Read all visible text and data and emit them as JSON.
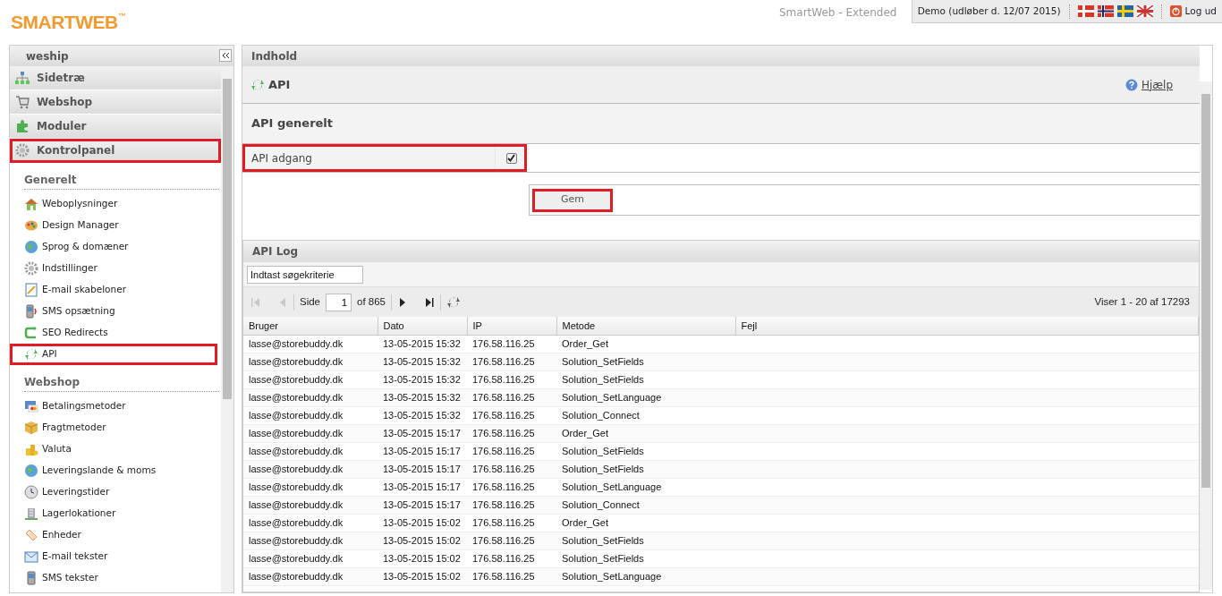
{
  "header": {
    "logo": "SMARTWEB",
    "logo_mark": "™",
    "edition": "SmartWeb - Extended",
    "account": "Demo (udløber d. 12/07 2015)",
    "logout": "Log ud"
  },
  "sidebar": {
    "title": "weship",
    "sections": [
      {
        "label": "Sidetræ",
        "highlighted": false
      },
      {
        "label": "Webshop",
        "highlighted": false
      },
      {
        "label": "Moduler",
        "highlighted": false
      },
      {
        "label": "Kontrolpanel",
        "highlighted": true
      }
    ],
    "groups": [
      {
        "heading": "Generelt",
        "items": [
          {
            "label": "Weboplysninger",
            "highlighted": false
          },
          {
            "label": "Design Manager",
            "highlighted": false
          },
          {
            "label": "Sprog & domæner",
            "highlighted": false
          },
          {
            "label": "Indstillinger",
            "highlighted": false
          },
          {
            "label": "E-mail skabeloner",
            "highlighted": false
          },
          {
            "label": "SMS opsætning",
            "highlighted": false
          },
          {
            "label": "SEO Redirects",
            "highlighted": false
          },
          {
            "label": "API",
            "highlighted": true
          }
        ]
      },
      {
        "heading": "Webshop",
        "items": [
          {
            "label": "Betalingsmetoder",
            "highlighted": false
          },
          {
            "label": "Fragtmetoder",
            "highlighted": false
          },
          {
            "label": "Valuta",
            "highlighted": false
          },
          {
            "label": "Leveringslande & moms",
            "highlighted": false
          },
          {
            "label": "Leveringstider",
            "highlighted": false
          },
          {
            "label": "Lagerlokationer",
            "highlighted": false
          },
          {
            "label": "Enheder",
            "highlighted": false
          },
          {
            "label": "E-mail tekster",
            "highlighted": false
          },
          {
            "label": "SMS tekster",
            "highlighted": false
          }
        ]
      }
    ]
  },
  "content": {
    "panel_title": "Indhold",
    "page_title": "API",
    "help": "Hjælp",
    "section_title": "API generelt",
    "field": {
      "label": "API adgang",
      "checked": true,
      "highlighted": true
    },
    "save": {
      "label": "Gem",
      "highlighted": true
    },
    "log": {
      "title": "API Log",
      "search": {
        "placeholder": "Indtast søgekriterie"
      },
      "pager": {
        "buttons": [
          {
            "disabled": true
          },
          {
            "disabled": true
          },
          {
            "disabled": false
          },
          {
            "disabled": false
          }
        ],
        "label": "Side",
        "page": "1",
        "of": "of 865",
        "summary": "Viser 1 - 20 af 17293"
      },
      "columns": [
        "Bruger",
        "Dato",
        "IP",
        "Metode",
        "Fejl"
      ],
      "rows": [
        [
          "lasse@storebuddy.dk",
          "13-05-2015 15:32",
          "176.58.116.25",
          "Order_Get"
        ],
        [
          "lasse@storebuddy.dk",
          "13-05-2015 15:32",
          "176.58.116.25",
          "Solution_SetFields"
        ],
        [
          "lasse@storebuddy.dk",
          "13-05-2015 15:32",
          "176.58.116.25",
          "Solution_SetFields"
        ],
        [
          "lasse@storebuddy.dk",
          "13-05-2015 15:32",
          "176.58.116.25",
          "Solution_SetLanguage"
        ],
        [
          "lasse@storebuddy.dk",
          "13-05-2015 15:32",
          "176.58.116.25",
          "Solution_Connect"
        ],
        [
          "lasse@storebuddy.dk",
          "13-05-2015 15:17",
          "176.58.116.25",
          "Order_Get"
        ],
        [
          "lasse@storebuddy.dk",
          "13-05-2015 15:17",
          "176.58.116.25",
          "Solution_SetFields"
        ],
        [
          "lasse@storebuddy.dk",
          "13-05-2015 15:17",
          "176.58.116.25",
          "Solution_SetFields"
        ],
        [
          "lasse@storebuddy.dk",
          "13-05-2015 15:17",
          "176.58.116.25",
          "Solution_SetLanguage"
        ],
        [
          "lasse@storebuddy.dk",
          "13-05-2015 15:17",
          "176.58.116.25",
          "Solution_Connect"
        ],
        [
          "lasse@storebuddy.dk",
          "13-05-2015 15:02",
          "176.58.116.25",
          "Order_Get"
        ],
        [
          "lasse@storebuddy.dk",
          "13-05-2015 15:02",
          "176.58.116.25",
          "Solution_SetFields"
        ],
        [
          "lasse@storebuddy.dk",
          "13-05-2015 15:02",
          "176.58.116.25",
          "Solution_SetFields"
        ],
        [
          "lasse@storebuddy.dk",
          "13-05-2015 15:02",
          "176.58.116.25",
          "Solution_SetLanguage"
        ]
      ]
    }
  }
}
